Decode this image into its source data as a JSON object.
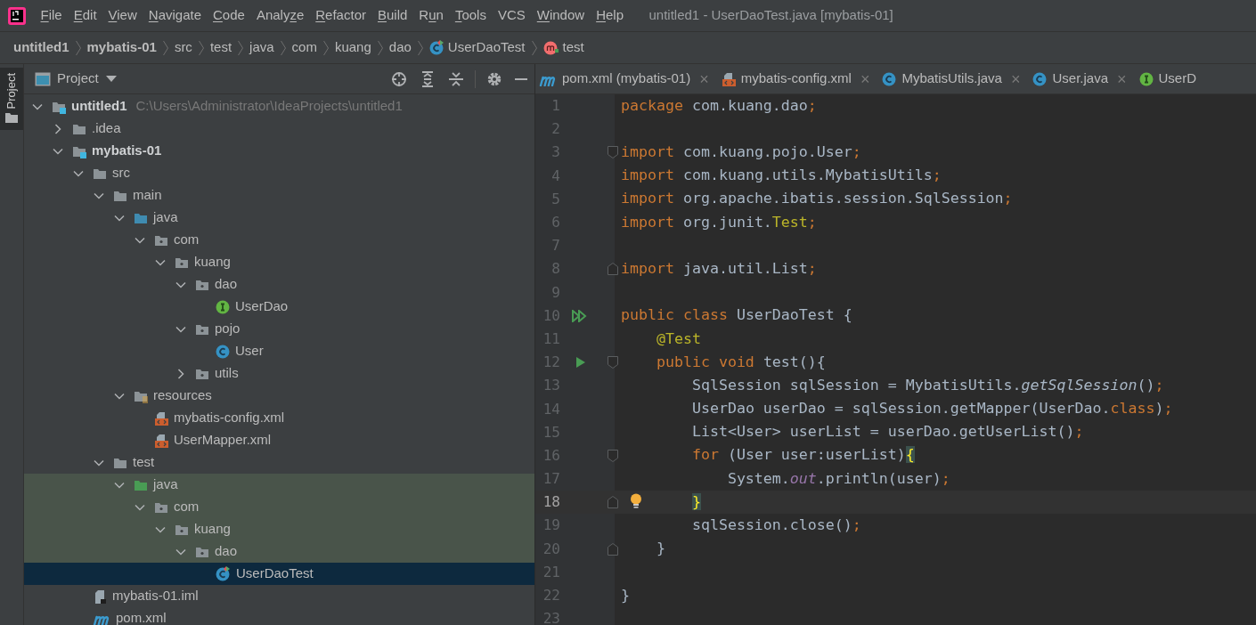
{
  "window": {
    "title": "untitled1 - UserDaoTest.java [mybatis-01]"
  },
  "menu": [
    {
      "key": "F",
      "after": "ile"
    },
    {
      "key": "E",
      "after": "dit"
    },
    {
      "key": "V",
      "after": "iew"
    },
    {
      "key": "N",
      "after": "avigate"
    },
    {
      "key": "C",
      "after": "ode"
    },
    {
      "before": "Analy",
      "key": "z",
      "after": "e"
    },
    {
      "key": "R",
      "after": "efactor"
    },
    {
      "key": "B",
      "after": "uild"
    },
    {
      "before": "R",
      "key": "u",
      "after": "n"
    },
    {
      "key": "T",
      "after": "ools"
    },
    {
      "before": "VCS"
    },
    {
      "key": "W",
      "after": "indow"
    },
    {
      "key": "H",
      "after": "elp"
    }
  ],
  "breadcrumbs": [
    {
      "label": "untitled1",
      "kind": "bold"
    },
    {
      "label": "mybatis-01",
      "kind": "bold"
    },
    {
      "label": "src",
      "kind": "plain"
    },
    {
      "label": "test",
      "kind": "plain"
    },
    {
      "label": "java",
      "kind": "plain"
    },
    {
      "label": "com",
      "kind": "plain"
    },
    {
      "label": "kuang",
      "kind": "plain"
    },
    {
      "label": "dao",
      "kind": "plain"
    },
    {
      "label": "UserDaoTest",
      "kind": "class"
    },
    {
      "label": "test",
      "kind": "method"
    }
  ],
  "side_stripe": {
    "label": "Project",
    "selected": true
  },
  "project_panel": {
    "title": "Project",
    "tree": [
      {
        "label": "untitled1",
        "kind": "module",
        "path": "C:\\Users\\Administrator\\IdeaProjects\\untitled1",
        "expanded": true,
        "selected": false,
        "highlighted": false,
        "children": [
          {
            "label": ".idea",
            "kind": "folder",
            "expanded": false,
            "selected": false,
            "highlighted": false
          },
          {
            "label": "mybatis-01",
            "kind": "module",
            "expanded": true,
            "selected": false,
            "highlighted": false,
            "children": [
              {
                "label": "src",
                "kind": "folder",
                "expanded": true,
                "selected": false,
                "highlighted": false,
                "children": [
                  {
                    "label": "main",
                    "kind": "folder",
                    "expanded": true,
                    "selected": false,
                    "highlighted": false,
                    "children": [
                      {
                        "label": "java",
                        "kind": "source_root",
                        "expanded": true,
                        "selected": false,
                        "highlighted": false,
                        "children": [
                          {
                            "label": "com",
                            "kind": "package",
                            "expanded": true,
                            "selected": false,
                            "highlighted": false,
                            "children": [
                              {
                                "label": "kuang",
                                "kind": "package",
                                "expanded": true,
                                "selected": false,
                                "highlighted": false,
                                "children": [
                                  {
                                    "label": "dao",
                                    "kind": "package",
                                    "expanded": true,
                                    "selected": false,
                                    "highlighted": false,
                                    "children": [
                                      {
                                        "label": "UserDao",
                                        "kind": "interface",
                                        "selected": false,
                                        "highlighted": false
                                      }
                                    ]
                                  },
                                  {
                                    "label": "pojo",
                                    "kind": "package",
                                    "expanded": true,
                                    "selected": false,
                                    "highlighted": false,
                                    "children": [
                                      {
                                        "label": "User",
                                        "kind": "class",
                                        "selected": false,
                                        "highlighted": false
                                      }
                                    ]
                                  },
                                  {
                                    "label": "utils",
                                    "kind": "package",
                                    "expanded": false,
                                    "selected": false,
                                    "highlighted": false
                                  }
                                ]
                              }
                            ]
                          }
                        ]
                      },
                      {
                        "label": "resources",
                        "kind": "resources",
                        "expanded": true,
                        "selected": false,
                        "highlighted": false,
                        "children": [
                          {
                            "label": "mybatis-config.xml",
                            "kind": "xml",
                            "selected": false,
                            "highlighted": false
                          },
                          {
                            "label": "UserMapper.xml",
                            "kind": "xml",
                            "selected": false,
                            "highlighted": false
                          }
                        ]
                      }
                    ]
                  },
                  {
                    "label": "test",
                    "kind": "folder",
                    "expanded": true,
                    "selected": false,
                    "highlighted": false,
                    "children": [
                      {
                        "label": "java",
                        "kind": "test_root",
                        "expanded": true,
                        "selected": false,
                        "highlighted": true,
                        "children": [
                          {
                            "label": "com",
                            "kind": "package",
                            "expanded": true,
                            "selected": false,
                            "highlighted": true,
                            "children": [
                              {
                                "label": "kuang",
                                "kind": "package",
                                "expanded": true,
                                "selected": false,
                                "highlighted": true,
                                "children": [
                                  {
                                    "label": "dao",
                                    "kind": "package",
                                    "expanded": true,
                                    "selected": false,
                                    "highlighted": true,
                                    "children": [
                                      {
                                        "label": "UserDaoTest",
                                        "kind": "test_class",
                                        "selected": true,
                                        "highlighted": false
                                      }
                                    ]
                                  }
                                ]
                              }
                            ]
                          }
                        ]
                      }
                    ]
                  }
                ]
              },
              {
                "label": "mybatis-01.iml",
                "kind": "iml",
                "selected": false,
                "highlighted": false
              },
              {
                "label": "pom.xml",
                "kind": "maven",
                "selected": false,
                "highlighted": false
              }
            ]
          }
        ]
      }
    ]
  },
  "editor_tabs": [
    {
      "label": "pom.xml (mybatis-01)",
      "kind": "maven",
      "closable": true,
      "selected": false
    },
    {
      "label": "mybatis-config.xml",
      "kind": "xml",
      "closable": true,
      "selected": false
    },
    {
      "label": "MybatisUtils.java",
      "kind": "class",
      "closable": true,
      "selected": false
    },
    {
      "label": "User.java",
      "kind": "class",
      "closable": true,
      "selected": false
    },
    {
      "label": "UserD",
      "kind": "interface",
      "closable": false,
      "selected": false
    }
  ],
  "tab_close_glyph": "×",
  "code_lines": [
    {
      "number": "1",
      "current": false,
      "tokens": [
        {
          "kind": "kw",
          "text": "package"
        },
        {
          "kind": "txt",
          "text": " com.kuang.dao"
        },
        {
          "kind": "kw",
          "text": ";"
        }
      ]
    },
    {
      "number": "2",
      "current": false
    },
    {
      "number": "3",
      "current": false,
      "gutter": [
        {
          "kind": "fold_start"
        }
      ],
      "tokens": [
        {
          "kind": "kw",
          "text": "import"
        },
        {
          "kind": "txt",
          "text": " com.kuang.pojo.User"
        },
        {
          "kind": "kw",
          "text": ";"
        }
      ]
    },
    {
      "number": "4",
      "current": false,
      "tokens": [
        {
          "kind": "kw",
          "text": "import"
        },
        {
          "kind": "txt",
          "text": " com.kuang.utils.MybatisUtils"
        },
        {
          "kind": "kw",
          "text": ";"
        }
      ]
    },
    {
      "number": "5",
      "current": false,
      "tokens": [
        {
          "kind": "kw",
          "text": "import"
        },
        {
          "kind": "txt",
          "text": " org.apache.ibatis.session.SqlSession"
        },
        {
          "kind": "kw",
          "text": ";"
        }
      ]
    },
    {
      "number": "6",
      "current": false,
      "tokens": [
        {
          "kind": "kw",
          "text": "import"
        },
        {
          "kind": "txt",
          "text": " org.junit."
        },
        {
          "kind": "ann",
          "text": "Test"
        },
        {
          "kind": "kw",
          "text": ";"
        }
      ]
    },
    {
      "number": "7",
      "current": false
    },
    {
      "number": "8",
      "current": false,
      "gutter": [
        {
          "kind": "fold_end"
        }
      ],
      "tokens": [
        {
          "kind": "kw",
          "text": "import"
        },
        {
          "kind": "txt",
          "text": " java.util.List"
        },
        {
          "kind": "kw",
          "text": ";"
        }
      ]
    },
    {
      "number": "9",
      "current": false
    },
    {
      "number": "10",
      "current": false,
      "gutter": [
        {
          "kind": "run_class"
        }
      ],
      "tokens": [
        {
          "kind": "kw",
          "text": "public class"
        },
        {
          "kind": "txt",
          "text": " UserDaoTest {"
        }
      ]
    },
    {
      "number": "11",
      "current": false,
      "tokens": [
        {
          "kind": "ann",
          "text": "    @Test"
        }
      ]
    },
    {
      "number": "12",
      "current": false,
      "gutter": [
        {
          "kind": "run_method"
        },
        {
          "kind": "fold_start"
        }
      ],
      "tokens": [
        {
          "kind": "kw",
          "text": "    public void"
        },
        {
          "kind": "txt",
          "text": " test(){"
        }
      ]
    },
    {
      "number": "13",
      "current": false,
      "tokens": [
        {
          "kind": "txt",
          "text": "        SqlSession sqlSession = MybatisUtils."
        },
        {
          "kind": "static",
          "text": "getSqlSession"
        },
        {
          "kind": "txt",
          "text": "()"
        },
        {
          "kind": "kw",
          "text": ";"
        }
      ]
    },
    {
      "number": "14",
      "current": false,
      "tokens": [
        {
          "kind": "txt",
          "text": "        UserDao userDao = sqlSession.getMapper(UserDao."
        },
        {
          "kind": "kw",
          "text": "class"
        },
        {
          "kind": "txt",
          "text": ")"
        },
        {
          "kind": "kw",
          "text": ";"
        }
      ]
    },
    {
      "number": "15",
      "current": false,
      "tokens": [
        {
          "kind": "txt",
          "text": "        List<User> userList = userDao.getUserList()"
        },
        {
          "kind": "kw",
          "text": ";"
        }
      ]
    },
    {
      "number": "16",
      "current": false,
      "gutter": [
        {
          "kind": "fold_start"
        }
      ],
      "tokens": [
        {
          "kind": "kw",
          "text": "        for"
        },
        {
          "kind": "txt",
          "text": " (User user:userList)"
        },
        {
          "kind": "match",
          "text": "{"
        }
      ]
    },
    {
      "number": "17",
      "current": false,
      "tokens": [
        {
          "kind": "txt",
          "text": "            System."
        },
        {
          "kind": "field",
          "text": "out"
        },
        {
          "kind": "txt",
          "text": ".println(user)"
        },
        {
          "kind": "kw",
          "text": ";"
        }
      ]
    },
    {
      "number": "18",
      "current": true,
      "gutter": [
        {
          "kind": "fold_end"
        },
        {
          "kind": "bulb"
        }
      ],
      "tokens": [
        {
          "kind": "match",
          "text": "        }"
        }
      ]
    },
    {
      "number": "19",
      "current": false,
      "tokens": [
        {
          "kind": "txt",
          "text": "        sqlSession.close()"
        },
        {
          "kind": "kw",
          "text": ";"
        }
      ]
    },
    {
      "number": "20",
      "current": false,
      "gutter": [
        {
          "kind": "fold_end"
        }
      ],
      "tokens": [
        {
          "kind": "txt",
          "text": "    }"
        }
      ]
    },
    {
      "number": "21",
      "current": false
    },
    {
      "number": "22",
      "current": false,
      "tokens": [
        {
          "kind": "txt",
          "text": "}"
        }
      ]
    },
    {
      "number": "23",
      "current": false
    }
  ]
}
